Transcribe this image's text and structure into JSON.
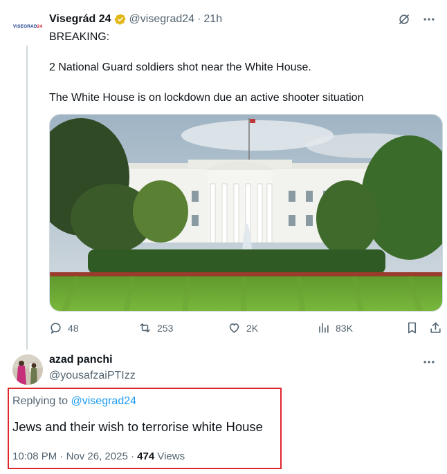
{
  "parent_tweet": {
    "avatar_logo": {
      "main": "VISEGRAD",
      "accent": "24"
    },
    "display_name": "Visegrád 24",
    "handle": "@visegrad24",
    "separator": "·",
    "time": "21h",
    "text_lines": [
      "BREAKING:",
      "2 National Guard soldiers shot near the White House.",
      "The White House is on lockdown due an active shooter situation"
    ],
    "media_icon": "white-house-photo",
    "actions": {
      "reply": {
        "icon": "reply-icon",
        "count": "48"
      },
      "repost": {
        "icon": "repost-icon",
        "count": "253"
      },
      "like": {
        "icon": "like-icon",
        "count": "2K"
      },
      "views": {
        "icon": "views-icon",
        "count": "83K"
      },
      "bookmark": {
        "icon": "bookmark-icon"
      },
      "share": {
        "icon": "share-icon"
      }
    }
  },
  "reply_tweet": {
    "display_name": "azad panchi",
    "handle": "@yousafzaiPTIzz",
    "replying_prefix": "Replying to",
    "replying_to": "@visegrad24",
    "text": "Jews and their wish to terrorise white House",
    "time": "10:08 PM",
    "separator": "·",
    "date": "Nov 26, 2025",
    "separator2": "·",
    "views_count": "474",
    "views_label": "Views"
  },
  "colors": {
    "text_primary": "#0f1419",
    "text_secondary": "#536471",
    "link": "#1d9bf0",
    "highlight": "#e0242c",
    "verified_gold": "#e2b719"
  }
}
